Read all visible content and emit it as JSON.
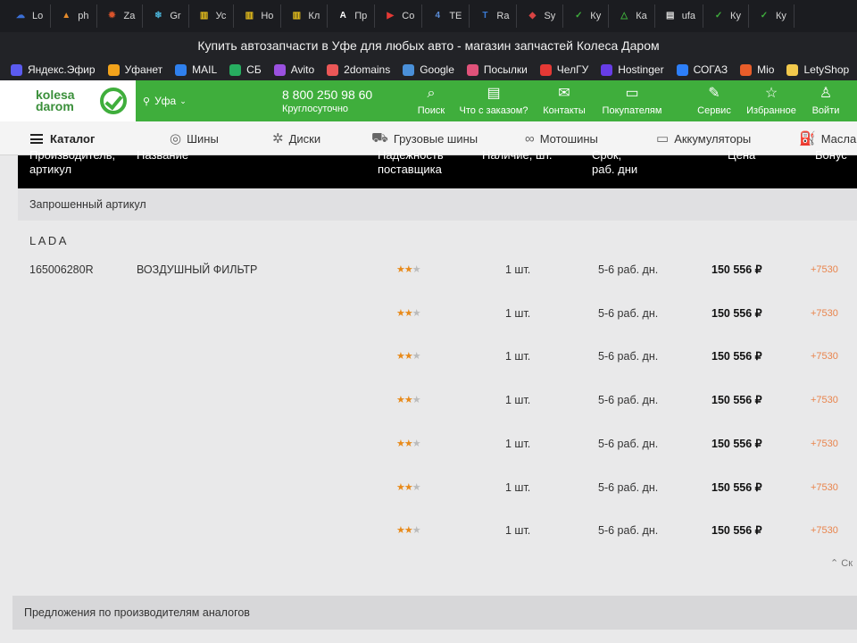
{
  "browser": {
    "tabs": [
      {
        "label": "Lo",
        "icon": "cloud-icon",
        "color": "#3b6fd6"
      },
      {
        "label": "ph",
        "icon": "php-icon",
        "color": "#e58b2b"
      },
      {
        "label": "Za",
        "icon": "gear-icon",
        "color": "#d9532b"
      },
      {
        "label": "Gr",
        "icon": "snowflake-icon",
        "color": "#4ab3d8"
      },
      {
        "label": "Ус",
        "icon": "bars-icon",
        "color": "#e8c01c"
      },
      {
        "label": "Но",
        "icon": "bars-icon",
        "color": "#e8c01c"
      },
      {
        "label": "Кл",
        "icon": "bars-icon",
        "color": "#e8c01c"
      },
      {
        "label": "Пр",
        "icon": "letter-a-icon",
        "color": "#ffffff"
      },
      {
        "label": "Co",
        "icon": "youtube-icon",
        "color": "#e53935"
      },
      {
        "label": "TE",
        "icon": "number-four-icon",
        "color": "#5b8dd9"
      },
      {
        "label": "Ra",
        "icon": "letter-t-icon",
        "color": "#3a7bd5"
      },
      {
        "label": "Sy",
        "icon": "diamond-icon",
        "color": "#d84343"
      },
      {
        "label": "Ку",
        "icon": "check-circle-icon",
        "color": "#3fae3c"
      },
      {
        "label": "Ка",
        "icon": "triangle-circle-icon",
        "color": "#3fae3c"
      },
      {
        "label": "ufa",
        "icon": "document-icon",
        "color": "#dddddd"
      },
      {
        "label": "Ку",
        "icon": "check-circle-icon",
        "color": "#3fae3c"
      },
      {
        "label": "Ку",
        "icon": "check-circle-icon",
        "color": "#3fae3c"
      }
    ],
    "window_title": "Купить автозапчасти в Уфе для любых авто - магазин запчастей Колеса Даром",
    "bookmarks": [
      {
        "label": "Яндекс.Эфир",
        "icon": "yandex-efir-icon",
        "color": "#5b5bf0"
      },
      {
        "label": "Уфанет",
        "icon": "ufanet-icon",
        "color": "#f2a31b"
      },
      {
        "label": "MAIL",
        "icon": "mail-at-icon",
        "color": "#2f80ed"
      },
      {
        "label": "СБ",
        "icon": "sber-icon",
        "color": "#27ae60"
      },
      {
        "label": "Avito",
        "icon": "avito-icon",
        "color": "#9b51e0"
      },
      {
        "label": "2domains",
        "icon": "2domains-icon",
        "color": "#eb5757"
      },
      {
        "label": "Google",
        "icon": "folder-icon",
        "color": "#4a90d9"
      },
      {
        "label": "Посылки",
        "icon": "gift-icon",
        "color": "#e0527a"
      },
      {
        "label": "ЧелГУ",
        "icon": "chelgu-icon",
        "color": "#e53935"
      },
      {
        "label": "Hostinger",
        "icon": "hostinger-icon",
        "color": "#673de6"
      },
      {
        "label": "СОГАЗ",
        "icon": "sogaz-icon",
        "color": "#2d7ff9"
      },
      {
        "label": "Mio",
        "icon": "mio-icon",
        "color": "#e85d2a"
      },
      {
        "label": "LetyShop",
        "icon": "bulb-icon",
        "color": "#f2c94c"
      }
    ]
  },
  "site": {
    "logo_line1": "kolesa",
    "logo_line2": "darom",
    "city": "Уфа",
    "phone": "8 800 250 98 60",
    "phone_sub": "Круглосуточно",
    "nav": [
      {
        "label": "Поиск",
        "icon": "search-icon"
      },
      {
        "label": "Что с заказом?",
        "icon": "receipt-icon"
      },
      {
        "label": "Контакты",
        "icon": "envelope-icon"
      },
      {
        "label": "Покупателям",
        "icon": "cards-icon"
      },
      {
        "label": "Сервис",
        "icon": "wrench-icon"
      },
      {
        "label": "Избранное",
        "icon": "star-icon"
      },
      {
        "label": "Войти",
        "icon": "user-icon"
      }
    ],
    "catalog": [
      {
        "label": "Каталог",
        "icon": "menu-icon"
      },
      {
        "label": "Шины",
        "icon": "tire-icon"
      },
      {
        "label": "Диски",
        "icon": "wheel-icon"
      },
      {
        "label": "Грузовые шины",
        "icon": "truck-icon"
      },
      {
        "label": "Мотошины",
        "icon": "motorcycle-icon"
      },
      {
        "label": "Аккумуляторы",
        "icon": "battery-icon"
      },
      {
        "label": "Масла",
        "icon": "oil-can-icon"
      }
    ]
  },
  "table": {
    "headers": {
      "col1_top": "Производитель,",
      "col1": "артикул",
      "col2": "Название",
      "col3_top": "Надежность",
      "col3": "поставщика",
      "col4": "Наличие, шт.",
      "col5_top": "Срок,",
      "col5": "раб. дни",
      "col6": "Цена",
      "col7": "Бонус"
    },
    "requested_label": "Запрошенный артикул",
    "brand": "LADA",
    "rows": [
      {
        "article": "165006280R",
        "name": "ВОЗДУШНЫЙ ФИЛЬТР",
        "rating": 2,
        "qty": "1 шт.",
        "term": "5-6 раб. дн.",
        "price": "150 556 ₽",
        "bonus": "+7530"
      },
      {
        "article": "",
        "name": "",
        "rating": 2,
        "qty": "1 шт.",
        "term": "5-6 раб. дн.",
        "price": "150 556 ₽",
        "bonus": "+7530"
      },
      {
        "article": "",
        "name": "",
        "rating": 2,
        "qty": "1 шт.",
        "term": "5-6 раб. дн.",
        "price": "150 556 ₽",
        "bonus": "+7530"
      },
      {
        "article": "",
        "name": "",
        "rating": 2,
        "qty": "1 шт.",
        "term": "5-6 раб. дн.",
        "price": "150 556 ₽",
        "bonus": "+7530"
      },
      {
        "article": "",
        "name": "",
        "rating": 2,
        "qty": "1 шт.",
        "term": "5-6 раб. дн.",
        "price": "150 556 ₽",
        "bonus": "+7530"
      },
      {
        "article": "",
        "name": "",
        "rating": 2,
        "qty": "1 шт.",
        "term": "5-6 раб. дн.",
        "price": "150 556 ₽",
        "bonus": "+7530"
      },
      {
        "article": "",
        "name": "",
        "rating": 2,
        "qty": "1 шт.",
        "term": "5-6 раб. дн.",
        "price": "150 556 ₽",
        "bonus": "+7530"
      }
    ],
    "collapse_label": "Ск",
    "analogs_label": "Предложения по производителям аналогов"
  },
  "colors": {
    "brand_green": "#3fae3c",
    "star_on": "#e88a1a",
    "bonus": "#e9844c"
  }
}
